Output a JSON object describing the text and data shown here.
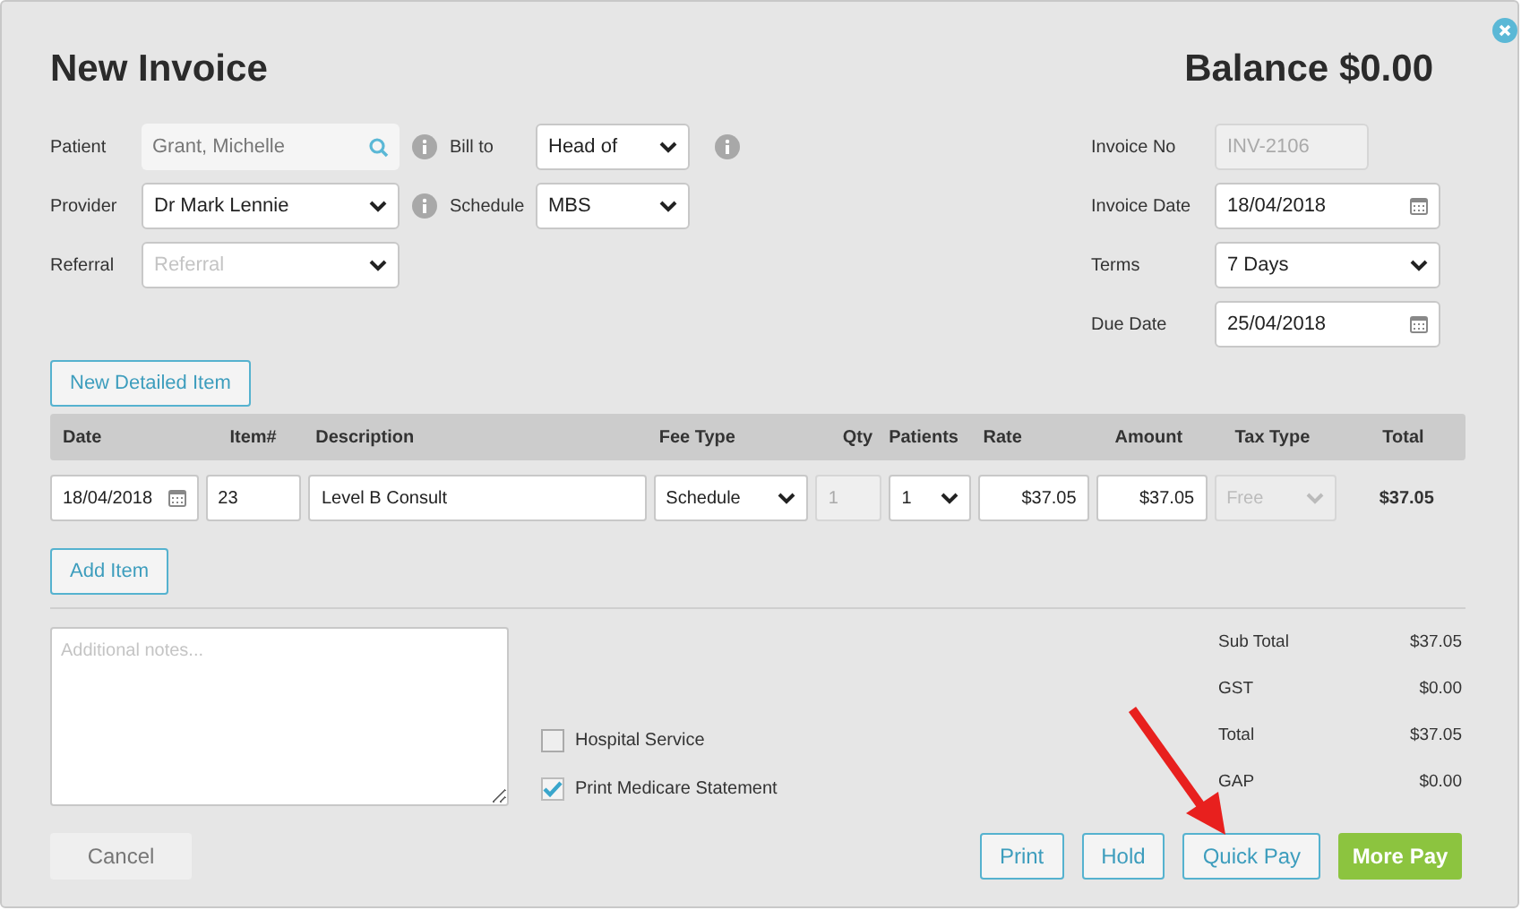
{
  "dialog": {
    "title": "New Invoice",
    "balance": "Balance $0.00"
  },
  "left_fields": [
    {
      "label": "Patient",
      "kind": "search",
      "value": "Grant, Michelle",
      "info": true,
      "extra": {
        "label": "Bill to",
        "kind": "select",
        "value": "Head of",
        "info": true
      }
    },
    {
      "label": "Provider",
      "kind": "select",
      "value": "Dr Mark Lennie",
      "info": true,
      "extra": {
        "label": "Schedule",
        "kind": "select",
        "value": "MBS",
        "info": false
      }
    },
    {
      "label": "Referral",
      "kind": "select",
      "placeholder": "Referral",
      "info": false
    }
  ],
  "right_fields": [
    {
      "label": "Invoice No",
      "kind": "readonly",
      "value": "INV-2106"
    },
    {
      "label": "Invoice Date",
      "kind": "date",
      "value": "18/04/2018"
    },
    {
      "label": "Terms",
      "kind": "select",
      "value": "7 Days"
    },
    {
      "label": "Due Date",
      "kind": "date",
      "value": "25/04/2018"
    }
  ],
  "new_item_button": "New Detailed Item",
  "table": {
    "columns": [
      "Date",
      "Item#",
      "Description",
      "Fee Type",
      "Qty",
      "Patients",
      "Rate",
      "Amount",
      "Tax Type",
      "Total"
    ],
    "rows": [
      {
        "cells": [
          {
            "kind": "date",
            "value": "18/04/2018"
          },
          {
            "kind": "text",
            "value": "23"
          },
          {
            "kind": "text",
            "value": "Level B Consult"
          },
          {
            "kind": "select",
            "value": "Schedule"
          },
          {
            "kind": "readonly",
            "value": "1"
          },
          {
            "kind": "select",
            "value": "1"
          },
          {
            "kind": "money",
            "value": "$37.05"
          },
          {
            "kind": "money",
            "value": "$37.05"
          },
          {
            "kind": "disabled_select",
            "value": "Free"
          },
          {
            "kind": "total",
            "value": "$37.05"
          }
        ]
      }
    ]
  },
  "add_item_button": "Add Item",
  "notes": {
    "placeholder": "Additional notes..."
  },
  "options": [
    {
      "label": "Hospital Service",
      "checked": false
    },
    {
      "label": "Print Medicare Statement",
      "checked": true
    }
  ],
  "totals": [
    {
      "label": "Sub Total",
      "value": "$37.05"
    },
    {
      "label": "GST",
      "value": "$0.00"
    },
    {
      "label": "Total",
      "value": "$37.05"
    },
    {
      "label": "GAP",
      "value": "$0.00"
    }
  ],
  "buttons": [
    {
      "label": "Cancel",
      "kind": "plain"
    },
    {
      "label": "Print",
      "kind": "outline"
    },
    {
      "label": "Hold",
      "kind": "outline"
    },
    {
      "label": "Quick Pay",
      "kind": "outline"
    },
    {
      "label": "More Pay",
      "kind": "primary"
    }
  ]
}
